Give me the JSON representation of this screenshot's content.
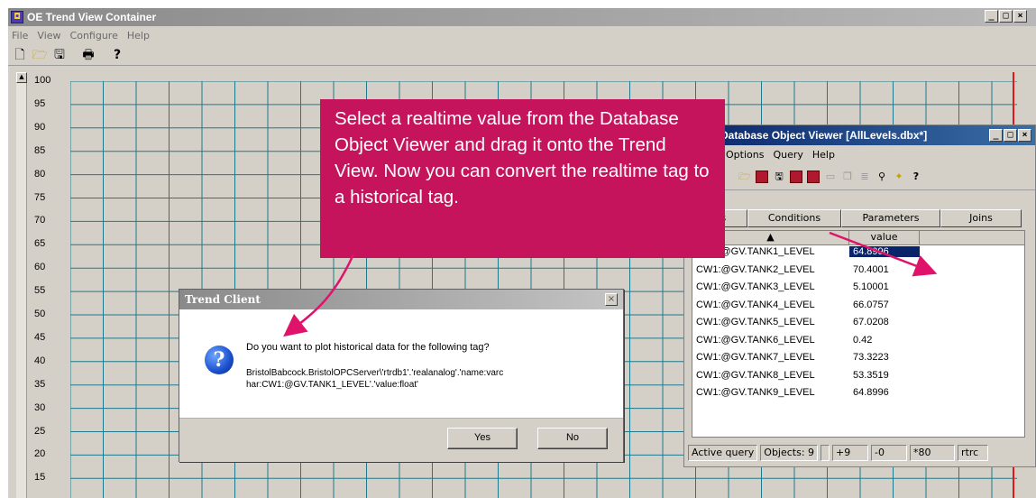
{
  "main_window": {
    "title": "OE Trend View Container",
    "menu": [
      "File",
      "View",
      "Configure",
      "Help"
    ],
    "toolbar_icons": [
      "new-file-icon",
      "open-folder-icon",
      "save-icon",
      "print-icon",
      "help-icon"
    ],
    "y_ticks": [
      "100",
      "95",
      "90",
      "85",
      "80",
      "75",
      "70",
      "65",
      "60",
      "55",
      "50",
      "45",
      "40",
      "35",
      "30",
      "25",
      "20",
      "15"
    ]
  },
  "db_viewer": {
    "title": "Database Object Viewer [AllLevels.dbx*]",
    "menu": [
      "Options",
      "Query",
      "Help"
    ],
    "tabs": [
      "bles",
      "Conditions",
      "Parameters",
      "Joins"
    ],
    "column_value": "value",
    "rows": [
      {
        "tag": "CW1:@GV.TANK1_LEVEL",
        "value": "64.8996",
        "selected": true
      },
      {
        "tag": "CW1:@GV.TANK2_LEVEL",
        "value": "70.4001"
      },
      {
        "tag": "CW1:@GV.TANK3_LEVEL",
        "value": "5.10001"
      },
      {
        "tag": "CW1:@GV.TANK4_LEVEL",
        "value": "66.0757"
      },
      {
        "tag": "CW1:@GV.TANK5_LEVEL",
        "value": "67.0208"
      },
      {
        "tag": "CW1:@GV.TANK6_LEVEL",
        "value": "0.42"
      },
      {
        "tag": "CW1:@GV.TANK7_LEVEL",
        "value": "73.3223"
      },
      {
        "tag": "CW1:@GV.TANK8_LEVEL",
        "value": "53.3519"
      },
      {
        "tag": "CW1:@GV.TANK9_LEVEL",
        "value": "64.8996"
      }
    ],
    "status": [
      "Active query",
      "Objects: 9",
      "+9",
      "-0",
      "*80",
      "rtrc"
    ]
  },
  "dialog": {
    "title": "Trend Client",
    "question": "Do you want to plot historical data for the following tag?",
    "tag_line1": "BristolBabcock.BristolOPCServer\\'rtrdb1'.'realanalog'.'name:varc",
    "tag_line2": "har:CW1:@GV.TANK1_LEVEL'.'value:float'",
    "yes_label": "Yes",
    "no_label": "No"
  },
  "callout": {
    "text": "Select a realtime value from the Database Object Viewer and drag it onto the Trend View. Now you can convert the realtime tag to a historical tag."
  },
  "colors": {
    "callout": "#c5145c",
    "grid": "#1e7a8c",
    "trend_line": "#e01818"
  }
}
